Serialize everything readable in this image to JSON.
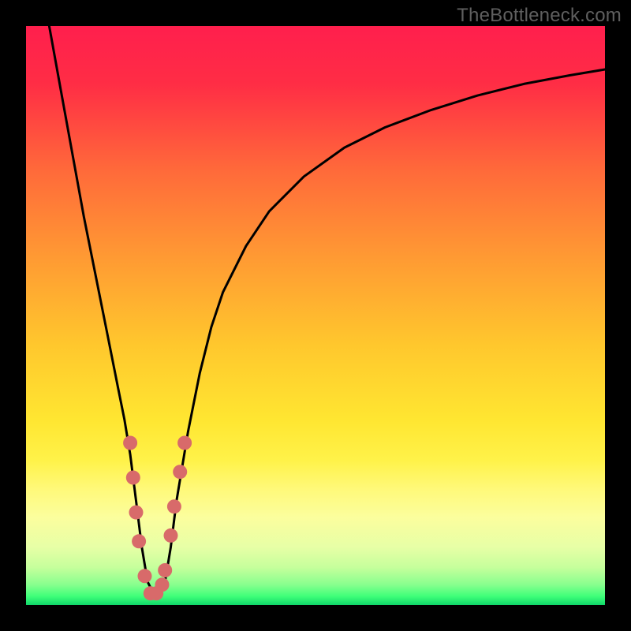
{
  "watermark": "TheBottleneck.com",
  "gradient_stops": [
    {
      "offset": 0,
      "color": "#ff1f4d"
    },
    {
      "offset": 0.1,
      "color": "#ff2d45"
    },
    {
      "offset": 0.25,
      "color": "#ff6a3a"
    },
    {
      "offset": 0.4,
      "color": "#ff9a33"
    },
    {
      "offset": 0.55,
      "color": "#ffc72d"
    },
    {
      "offset": 0.68,
      "color": "#ffe631"
    },
    {
      "offset": 0.75,
      "color": "#fff249"
    },
    {
      "offset": 0.8,
      "color": "#fff97a"
    },
    {
      "offset": 0.85,
      "color": "#fbfe9e"
    },
    {
      "offset": 0.9,
      "color": "#e7ffa6"
    },
    {
      "offset": 0.935,
      "color": "#c6ff9c"
    },
    {
      "offset": 0.965,
      "color": "#88ff8e"
    },
    {
      "offset": 0.985,
      "color": "#3fff79"
    },
    {
      "offset": 1.0,
      "color": "#10d86a"
    }
  ],
  "marker_color": "#d86a6a",
  "marker_radius": 9,
  "curve_color": "#000000",
  "curve_width": 3,
  "chart_data": {
    "type": "line",
    "title": "",
    "xlabel": "",
    "ylabel": "",
    "xlim": [
      0,
      100
    ],
    "ylim": [
      0,
      100
    ],
    "series": [
      {
        "name": "bottleneck-curve",
        "x": [
          4,
          6,
          8,
          10,
          12,
          14,
          16,
          17,
          18,
          19,
          20,
          21,
          22,
          23,
          24,
          25,
          26,
          28,
          30,
          32,
          34,
          38,
          42,
          48,
          55,
          62,
          70,
          78,
          86,
          94,
          100
        ],
        "y": [
          100,
          89,
          78,
          67,
          57,
          47,
          37,
          32,
          26,
          18,
          10,
          4,
          2,
          2,
          4,
          10,
          18,
          30,
          40,
          48,
          54,
          62,
          68,
          74,
          79,
          82.5,
          85.5,
          88,
          90,
          91.5,
          92.5
        ]
      }
    ],
    "markers": [
      {
        "x": 18.0,
        "y": 28
      },
      {
        "x": 18.5,
        "y": 22
      },
      {
        "x": 19.0,
        "y": 16
      },
      {
        "x": 19.5,
        "y": 11
      },
      {
        "x": 20.5,
        "y": 5
      },
      {
        "x": 21.5,
        "y": 2
      },
      {
        "x": 22.5,
        "y": 2
      },
      {
        "x": 23.5,
        "y": 3.5
      },
      {
        "x": 24.0,
        "y": 6
      },
      {
        "x": 25.0,
        "y": 12
      },
      {
        "x": 25.6,
        "y": 17
      },
      {
        "x": 26.6,
        "y": 23
      },
      {
        "x": 27.4,
        "y": 28
      }
    ]
  }
}
